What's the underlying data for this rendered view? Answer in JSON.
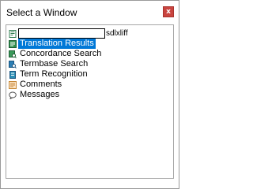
{
  "dialog": {
    "title": "Select a Window",
    "close_symbol": "x",
    "close_icon": "close-icon"
  },
  "edit_field": {
    "value": "",
    "suffix": "sdlxliff",
    "icon": "document-icon"
  },
  "items": [
    {
      "label": "Translation Results",
      "icon": "translation-results-icon",
      "selected": true
    },
    {
      "label": "Concordance Search",
      "icon": "concordance-search-icon",
      "selected": false
    },
    {
      "label": "Termbase Search",
      "icon": "termbase-search-icon",
      "selected": false
    },
    {
      "label": "Term Recognition",
      "icon": "term-recognition-icon",
      "selected": false
    },
    {
      "label": "Comments",
      "icon": "comments-icon",
      "selected": false
    },
    {
      "label": "Messages",
      "icon": "messages-icon",
      "selected": false
    }
  ],
  "colors": {
    "selection": "#0078d7",
    "close_button": "#c9443f"
  }
}
